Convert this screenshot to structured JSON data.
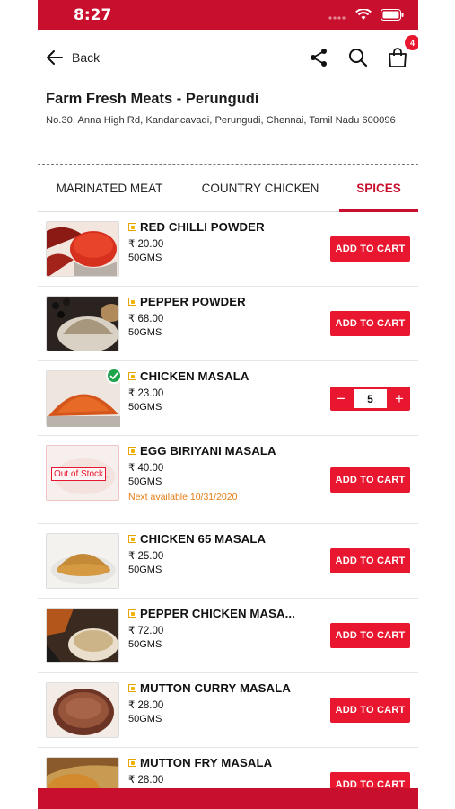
{
  "status_bar": {
    "time": "8:27"
  },
  "header": {
    "back_label": "Back",
    "cart_count": "4"
  },
  "store": {
    "name": "Farm Fresh Meats - Perungudi",
    "address": "No.30, Anna High Rd, Kandancavadi, Perungudi, Chennai, Tamil Nadu 600096"
  },
  "tabs": [
    {
      "label": "MARINATED MEAT",
      "active": false
    },
    {
      "label": "COUNTRY CHICKEN",
      "active": false
    },
    {
      "label": "SPICES",
      "active": true
    }
  ],
  "products": [
    {
      "name": "RED CHILLI POWDER",
      "price": "₹ 20.00",
      "qty": "50GMS",
      "action": "ADD TO CART"
    },
    {
      "name": "PEPPER POWDER",
      "price": "₹ 68.00",
      "qty": "50GMS",
      "action": "ADD TO CART"
    },
    {
      "name": "CHICKEN MASALA",
      "price": "₹ 23.00",
      "qty": "50GMS",
      "in_cart_qty": "5"
    },
    {
      "name": "EGG BIRIYANI MASALA",
      "price": "₹ 40.00",
      "qty": "50GMS",
      "action": "ADD TO CART",
      "stock_label": "Out of Stock",
      "next_available": "Next available 10/31/2020"
    },
    {
      "name": "CHICKEN 65 MASALA",
      "price": "₹ 25.00",
      "qty": "50GMS",
      "action": "ADD TO CART"
    },
    {
      "name": "PEPPER CHICKEN MASA...",
      "price": "₹ 72.00",
      "qty": "50GMS",
      "action": "ADD TO CART"
    },
    {
      "name": "MUTTON CURRY MASALA",
      "price": "₹ 28.00",
      "qty": "50GMS",
      "action": "ADD TO CART"
    },
    {
      "name": "MUTTON FRY MASALA",
      "price": "₹ 28.00",
      "action": "ADD TO CART"
    }
  ],
  "stepper": {
    "minus": "−",
    "plus": "+"
  },
  "colors": {
    "brand_red": "#c8102e",
    "button_red": "#e8162f",
    "next_available_orange": "#e47b14",
    "veg_mark": "#f0b400"
  },
  "icons": [
    "back-arrow-icon",
    "share-icon",
    "search-icon",
    "cart-bag-icon",
    "check-circle-icon",
    "wifi-icon",
    "battery-icon",
    "signal-icon"
  ]
}
